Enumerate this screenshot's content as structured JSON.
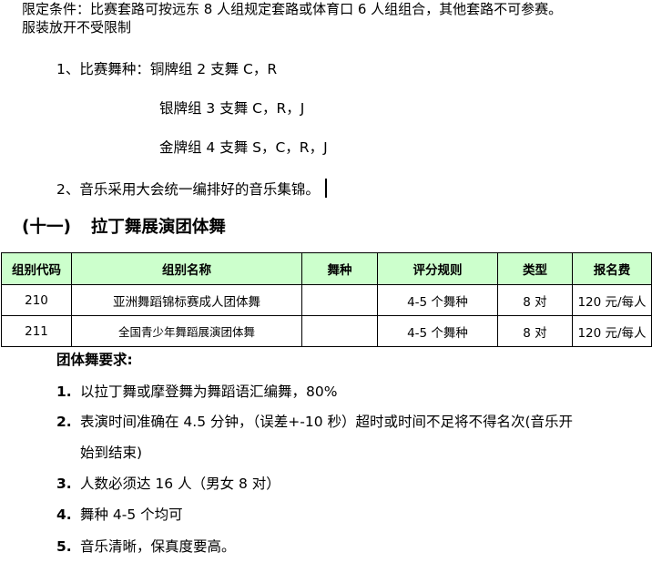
{
  "intro": {
    "line1": "限定条件：比赛套路可按远东 8 人组规定套路或体育口 6 人组组合，其他套路不可参赛。",
    "line2": "服装放开不受限制"
  },
  "list": [
    {
      "text": "1、比赛舞种：铜牌组 2 支舞 C，R"
    },
    {
      "text": "银牌组 3 支舞 C，R，J"
    },
    {
      "text": "金牌组 4 支舞 S，C，R，J"
    },
    {
      "text": "2、音乐采用大会统一编排好的音乐集锦。"
    }
  ],
  "section": {
    "number": "(十一)",
    "title": "拉丁舞展演团体舞"
  },
  "table": {
    "header_color": "#ccffcc",
    "headers": [
      "组别代码",
      "组别名称",
      "舞种",
      "评分规则",
      "类型",
      "报名费"
    ],
    "rows": [
      [
        "210",
        "亚洲舞蹈锦标赛成人团体舞",
        "",
        "4-5 个舞种",
        "8 对",
        "120 元/每人"
      ],
      [
        "211",
        "全国青少年舞蹈展演团体舞",
        "",
        "4-5 个舞种",
        "8 对",
        "120 元/每人"
      ]
    ]
  },
  "requirements": {
    "title": "团体舞要求:",
    "items": [
      {
        "num": "1.",
        "text": "以拉丁舞或摩登舞为舞蹈语汇编舞，80%"
      },
      {
        "num": "2.",
        "text": "表演时间准确在 4.5 分钟，（误差+-10 秒）超时或时间不足将不得名次(音乐开",
        "cont": "始到结束)"
      },
      {
        "num": "3.",
        "text": "人数必须达 16 人（男女 8 对）"
      },
      {
        "num": "4.",
        "text": "舞种 4-5 个均可"
      },
      {
        "num": "5.",
        "text": "音乐清晰，保真度要高。"
      }
    ]
  }
}
